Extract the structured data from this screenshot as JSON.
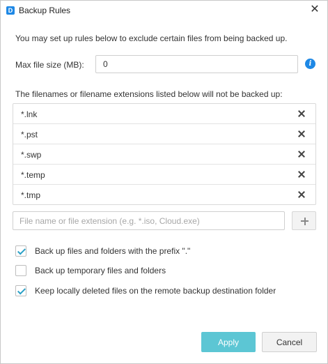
{
  "window": {
    "title": "Backup Rules",
    "logo_glyph": "D",
    "close_glyph": "✕"
  },
  "intro_text": "You may set up rules below to exclude certain files from being backed up.",
  "max_file_size": {
    "label": "Max file size (MB):",
    "value": "0",
    "info_glyph": "i"
  },
  "exclusions": {
    "caption": "The filenames or filename extensions listed below will not be backed up:",
    "items": [
      "*.lnk",
      "*.pst",
      "*.swp",
      "*.temp",
      "*.tmp"
    ]
  },
  "new_rule": {
    "placeholder": "File name or file extension (e.g. *.iso, Cloud.exe)",
    "value": ""
  },
  "options": [
    {
      "label": "Back up files and folders with the prefix \".\"",
      "checked": true
    },
    {
      "label": "Back up temporary files and folders",
      "checked": false
    },
    {
      "label": "Keep locally deleted files on the remote backup destination folder",
      "checked": true
    }
  ],
  "buttons": {
    "apply": "Apply",
    "cancel": "Cancel"
  },
  "colors": {
    "accent": "#1e88e5",
    "apply_bg": "#5cc6d4",
    "check": "#29a0c6"
  }
}
